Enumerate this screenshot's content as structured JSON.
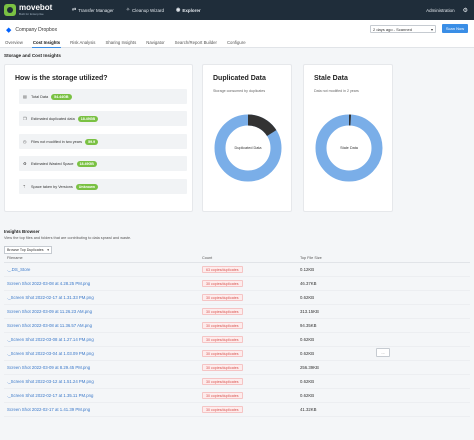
{
  "topbar": {
    "logo_name": "movebot",
    "logo_tag": "Built for Enterprise",
    "nav": [
      {
        "label": "Transfer Manager",
        "icon": "transfer-icon"
      },
      {
        "label": "Cleanup Wizard",
        "icon": "wand-icon"
      },
      {
        "label": "Explorer",
        "icon": "compass-icon"
      }
    ],
    "admin": "Administration"
  },
  "account": {
    "name": "Company Dropbox",
    "scan_select": "2 days ago - Scanned",
    "scan_button": "Scan Now"
  },
  "tabs": [
    "Overview",
    "Cost Insights",
    "Risk Analysis",
    "Sharing Insights",
    "Navigator",
    "Search/Report Builder",
    "Configure"
  ],
  "section_title": "Storage and Cost Insights",
  "storage": {
    "title": "How is the storage utilized?",
    "stats": [
      {
        "label": "Total Data",
        "value": "54.44GB",
        "icon": "database-icon"
      },
      {
        "label": "Estimated duplicated data",
        "value": "18.49GB",
        "icon": "copy-icon"
      },
      {
        "label": "Files not modified in two years",
        "value": "59.9",
        "icon": "clock-icon"
      },
      {
        "label": "Estimated Wasted Space",
        "value": "18.49GB",
        "icon": "trash-icon"
      },
      {
        "label": "Space taken by Versions",
        "value": "Unknown",
        "icon": "branch-icon"
      }
    ]
  },
  "duplicated": {
    "title": "Duplicated Data",
    "subtitle": "Storage consumed by duplicates",
    "center_label": "Duplicated Data",
    "fraction": 0.16
  },
  "stale": {
    "title": "Stale Data",
    "subtitle": "Data not modified in 2 years",
    "center_label": "Stale Data",
    "fraction": 0.01
  },
  "colors": {
    "accent": "#3a8ee6",
    "green": "#7ac143",
    "donut_main": "#7aaee8",
    "donut_slice": "#333333"
  },
  "insights": {
    "title": "Insights Browser",
    "subtitle": "View the top files and folders that are contributing to data sprawl and waste.",
    "select": "Browse Top Duplicates",
    "headers": [
      "Filename",
      "Count",
      "Top File Size"
    ],
    "more_label": "...",
    "rows": [
      {
        "name": "._.DS_Store",
        "count": "63 copies/duplicates",
        "size": "0.12KB"
      },
      {
        "name": "Screen Shot 2022-03-08 at 4.28.25 PM.png",
        "count": "30 copies/duplicates",
        "size": "46.37KB"
      },
      {
        "name": "._Screen Shot 2022-02-17 at 1.31.33 PM.png",
        "count": "30 copies/duplicates",
        "size": "0.62KB"
      },
      {
        "name": "Screen Shot 2022-03-09 at 11.26.23 AM.png",
        "count": "30 copies/duplicates",
        "size": "313.15KB"
      },
      {
        "name": "Screen Shot 2022-03-08 at 11.36.57 AM.png",
        "count": "30 copies/duplicates",
        "size": "94.35KB"
      },
      {
        "name": "._Screen Shot 2022-03-08 at 1.27.14 PM.png",
        "count": "30 copies/duplicates",
        "size": "0.62KB"
      },
      {
        "name": "._Screen Shot 2022-03-04 at 1.03.09 PM.png",
        "count": "30 copies/duplicates",
        "size": "0.62KB"
      },
      {
        "name": "Screen Shot 2022-03-09 at 8.29.45 PM.png",
        "count": "30 copies/duplicates",
        "size": "256.39KB"
      },
      {
        "name": "._Screen Shot 2022-03-12 at 1.51.24 PM.png",
        "count": "30 copies/duplicates",
        "size": "0.62KB"
      },
      {
        "name": "._Screen Shot 2022-02-17 at 1.35.11 PM.png",
        "count": "30 copies/duplicates",
        "size": "0.62KB"
      },
      {
        "name": "Screen Shot 2022-02-17 at 1.41.39 PM.png",
        "count": "30 copies/duplicates",
        "size": "41.32KB"
      }
    ]
  }
}
